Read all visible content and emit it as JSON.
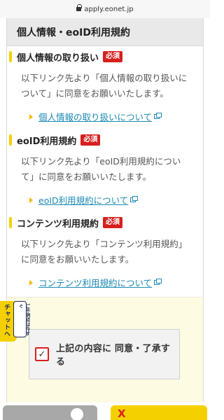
{
  "browser": {
    "url": "apply.eonet.jp"
  },
  "section": {
    "title": "個人情報・eoID利用規約"
  },
  "blocks": [
    {
      "title": "個人情報の取り扱い",
      "badge": "必須",
      "description": "以下リンク先より「個人情報の取り扱いについて」に同意をお願いいたします。",
      "link": "個人情報の取り扱いについて"
    },
    {
      "title": "eoID利用規約",
      "badge": "必須",
      "description": "以下リンク先より「eoID利用規約について」に同意をお願いいたします。",
      "link": "eoID利用規約について"
    },
    {
      "title": "コンテンツ利用規約",
      "badge": "必須",
      "description": "以下リンク先より「コンテンツ利用規約」に同意をお願いいたします。",
      "link": "コンテンツ利用規約について"
    }
  ],
  "agreement": {
    "label": "上記の内容に 同意・了承する",
    "checked": true,
    "check_mark": "✓"
  },
  "chat": {
    "label": "チャットへ",
    "sublabel": "ご不明点は今すぐ"
  },
  "footer": {
    "left_icon": "circle-icon",
    "right_icon": "x-icon",
    "right_mark": "X"
  },
  "colors": {
    "accent_yellow": "#f5d000",
    "required_red": "#d6201e",
    "link_blue": "#1b8ab5",
    "agree_bg": "#fefbe3"
  }
}
